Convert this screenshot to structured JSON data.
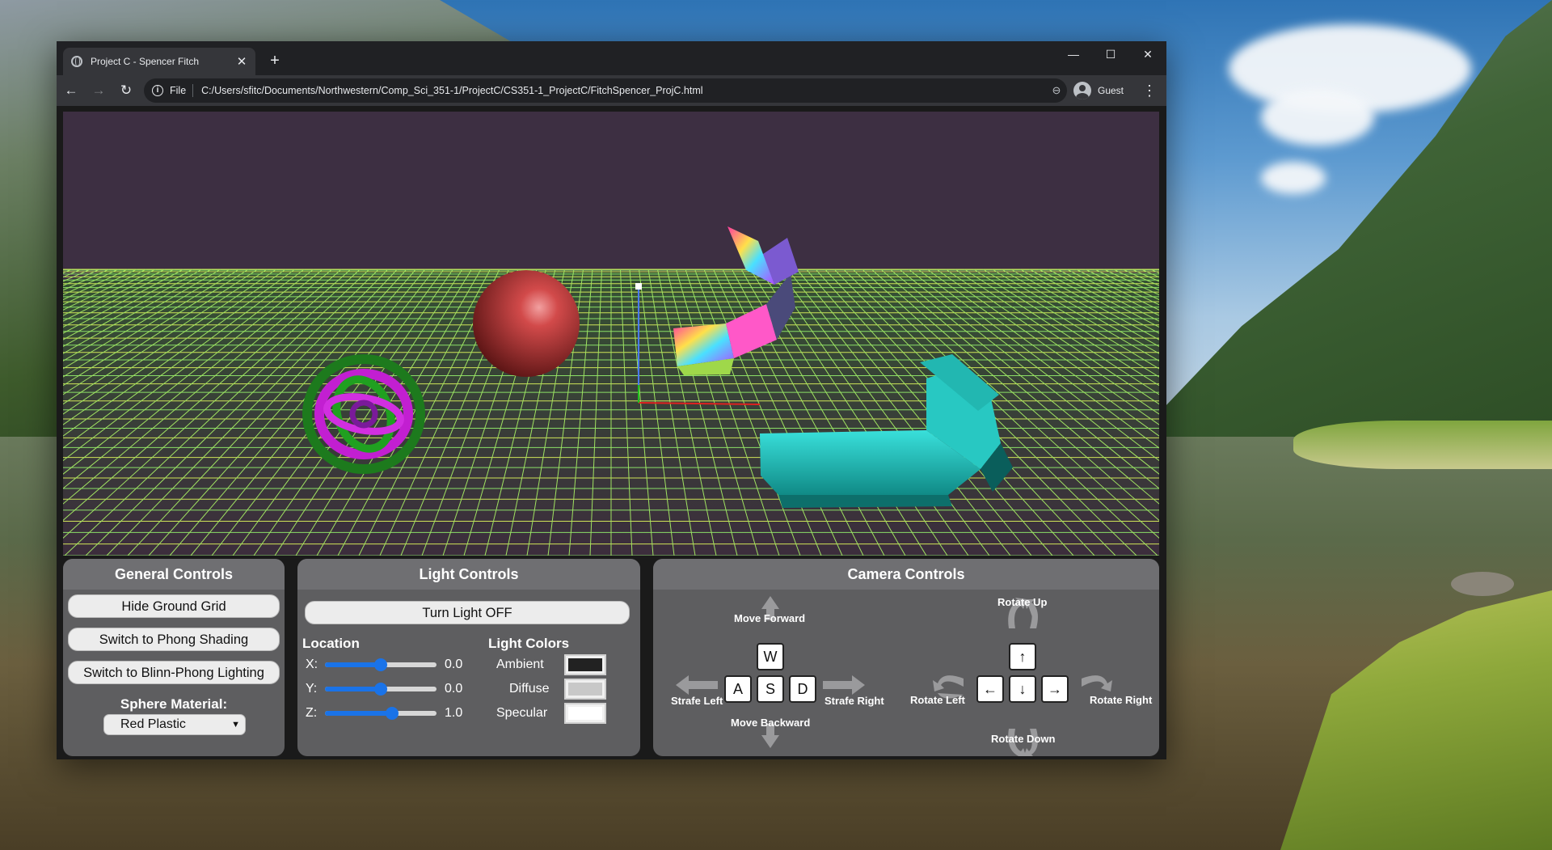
{
  "browser": {
    "tab_title": "Project C - Spencer Fitch",
    "tab_close": "✕",
    "new_tab": "+",
    "scheme": "File",
    "url": "C:/Users/sfitc/Documents/Northwestern/Comp_Sci_351-1/ProjectC/CS351-1_ProjectC/FitchSpencer_ProjC.html",
    "profile": "Guest",
    "window_controls": [
      "—",
      "☐",
      "✕"
    ]
  },
  "general": {
    "title": "General Controls",
    "buttons": [
      "Hide Ground Grid",
      "Switch to Phong Shading",
      "Switch to Blinn-Phong Lighting"
    ],
    "material_label": "Sphere Material:",
    "material_value": "Red Plastic"
  },
  "light": {
    "title": "Light Controls",
    "toggle": "Turn Light OFF",
    "location_label": "Location",
    "axes": [
      {
        "label": "X:",
        "value": "0.0",
        "fraction": 0.5
      },
      {
        "label": "Y:",
        "value": "0.0",
        "fraction": 0.5
      },
      {
        "label": "Z:",
        "value": "1.0",
        "fraction": 0.6
      }
    ],
    "colors_label": "Light Colors",
    "colors": [
      {
        "label": "Ambient",
        "color": "#222222"
      },
      {
        "label": "Diffuse",
        "color": "#c8c8c8"
      },
      {
        "label": "Specular",
        "color": "#ffffff"
      }
    ]
  },
  "camera": {
    "title": "Camera Controls",
    "keys": {
      "w": "W",
      "a": "A",
      "s": "S",
      "d": "D",
      "up": "↑",
      "left": "←",
      "down": "↓",
      "right": "→"
    },
    "move_forward": "Move Forward",
    "move_backward": "Move Backward",
    "strafe_left": "Strafe Left",
    "strafe_right": "Strafe Right",
    "rotate_up": "Rotate Up",
    "rotate_down": "Rotate Down",
    "rotate_left": "Rotate Left",
    "rotate_right": "Rotate Right"
  },
  "colors": {
    "scene_bg": "#3d2f42",
    "grid_line": "#9be86a",
    "grid_ground": "#b9e25a",
    "sphere": "#c43a3a",
    "accent": "#1a73e8",
    "panel": "#5e5e60"
  }
}
